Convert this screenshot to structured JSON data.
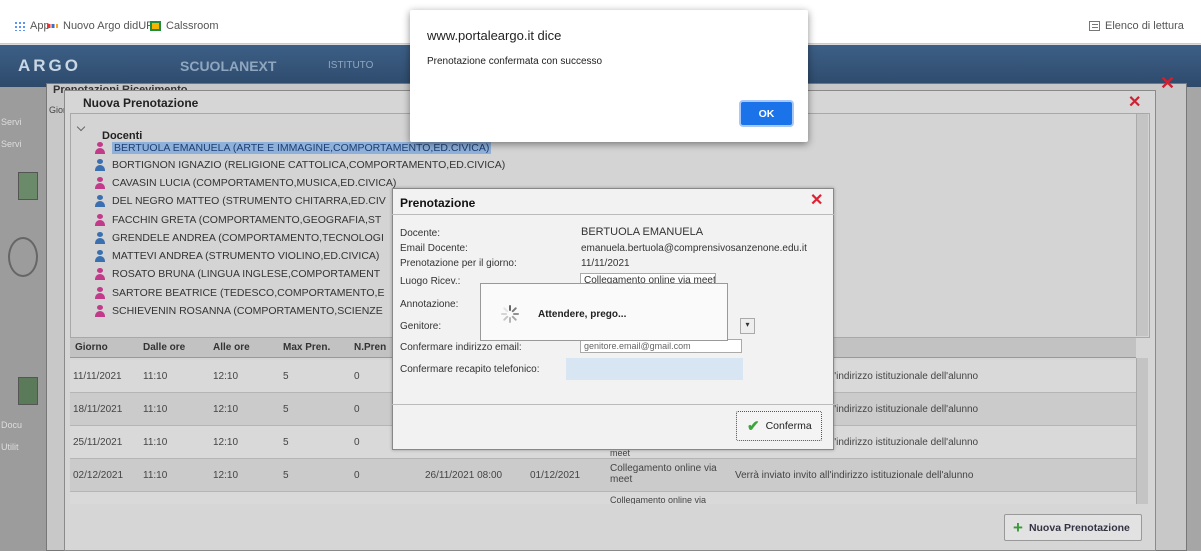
{
  "bookmarks": [
    {
      "label": "App",
      "icon": "apps-grid-icon"
    },
    {
      "label": "Nuovo Argo didUP",
      "icon": "argo-icon"
    },
    {
      "label": "Calssroom",
      "icon": "classroom-icon"
    }
  ],
  "reading_list": {
    "label": "Elenco di lettura",
    "icon": "reading-list-icon"
  },
  "app": {
    "logo": "ARGO",
    "brand": "SCUOLANEXT",
    "istituto": "ISTITUTO",
    "outer_window_title": "Prenotazioni Ricevimento",
    "side_labels": [
      "Giorn",
      "Servi",
      "Servi",
      "Docu",
      "Utilit"
    ]
  },
  "nuova_prenotazione": {
    "title": "Nuova Prenotazione",
    "tree_root": "Docenti",
    "docenti": [
      {
        "name": "BERTUOLA EMANUELA (ARTE E IMMAGINE,COMPORTAMENTO,ED.CIVICA)",
        "gender": "f",
        "selected": true
      },
      {
        "name": "BORTIGNON IGNAZIO (RELIGIONE CATTOLICA,COMPORTAMENTO,ED.CIVICA)",
        "gender": "m",
        "selected": false
      },
      {
        "name": "CAVASIN LUCIA (COMPORTAMENTO,MUSICA,ED.CIVICA)",
        "gender": "f",
        "selected": false
      },
      {
        "name": "DEL NEGRO MATTEO (STRUMENTO CHITARRA,ED.CIV",
        "gender": "m",
        "selected": false
      },
      {
        "name": "FACCHIN GRETA (COMPORTAMENTO,GEOGRAFIA,ST",
        "gender": "f",
        "selected": false
      },
      {
        "name": "GRENDELE ANDREA (COMPORTAMENTO,TECNOLOGI",
        "gender": "m",
        "selected": false
      },
      {
        "name": "MATTEVI ANDREA (STRUMENTO VIOLINO,ED.CIVICA)",
        "gender": "m",
        "selected": false
      },
      {
        "name": "ROSATO BRUNA (LINGUA INGLESE,COMPORTAMENT",
        "gender": "f",
        "selected": false
      },
      {
        "name": "SARTORE BEATRICE (TEDESCO,COMPORTAMENTO,E",
        "gender": "f",
        "selected": false
      },
      {
        "name": "SCHIEVENIN ROSANNA (COMPORTAMENTO,SCIENZE",
        "gender": "f",
        "selected": false
      }
    ],
    "table": {
      "headers": [
        "Giorno",
        "Dalle ore",
        "Alle ore",
        "Max Pren.",
        "N.Pren"
      ],
      "rows": [
        {
          "giorno": "11/11/2021",
          "dalle": "11:10",
          "alle": "12:10",
          "max": "5",
          "npren": "0",
          "note": "l'indirizzo istituzionale dell'alunno"
        },
        {
          "giorno": "18/11/2021",
          "dalle": "11:10",
          "alle": "12:10",
          "max": "5",
          "npren": "0",
          "note": "l'indirizzo istituzionale dell'alunno"
        },
        {
          "giorno": "25/11/2021",
          "dalle": "11:10",
          "alle": "12:10",
          "max": "5",
          "npren": "0",
          "note": "l'indirizzo istituzionale dell'alunno",
          "luogo_tail": "meet"
        },
        {
          "giorno": "02/12/2021",
          "dalle": "11:10",
          "alle": "12:10",
          "max": "5",
          "npren": "0",
          "data_inizio": "26/11/2021 08:00",
          "data_fine": "01/12/2021",
          "luogo": "Collegamento online via meet",
          "note": "Verrà inviato invito all'indirizzo istituzionale dell'alunno"
        }
      ],
      "partial_row_text": "Collegamento online via"
    },
    "new_button": "Nuova Prenotazione"
  },
  "prenotazione": {
    "title": "Prenotazione",
    "fields": {
      "docente": {
        "label": "Docente:",
        "value": "BERTUOLA EMANUELA"
      },
      "email": {
        "label": "Email Docente:",
        "value": "emanuela.bertuola@comprensivosanzenone.edu.it"
      },
      "giorno": {
        "label": "Prenotazione per il giorno:",
        "value": "11/11/2021"
      },
      "luogo": {
        "label": "Luogo Ricev.:",
        "value": "Collegamento online via meet"
      },
      "annotazione": {
        "label": "Annotazione:"
      },
      "genitore": {
        "label": "Genitore:"
      },
      "conferma_email": {
        "label": "Confermare indirizzo email:",
        "value": "genitore.email@gmail.com"
      },
      "conferma_tel": {
        "label": "Confermare recapito telefonico:",
        "value": ""
      }
    },
    "confirm_button": "Conferma"
  },
  "loading": {
    "text": "Attendere, prego..."
  },
  "alert": {
    "title": "www.portaleargo.it dice",
    "message": "Prenotazione confermata con successo",
    "ok_label": "OK",
    "ok_color": "#1a73e8"
  }
}
